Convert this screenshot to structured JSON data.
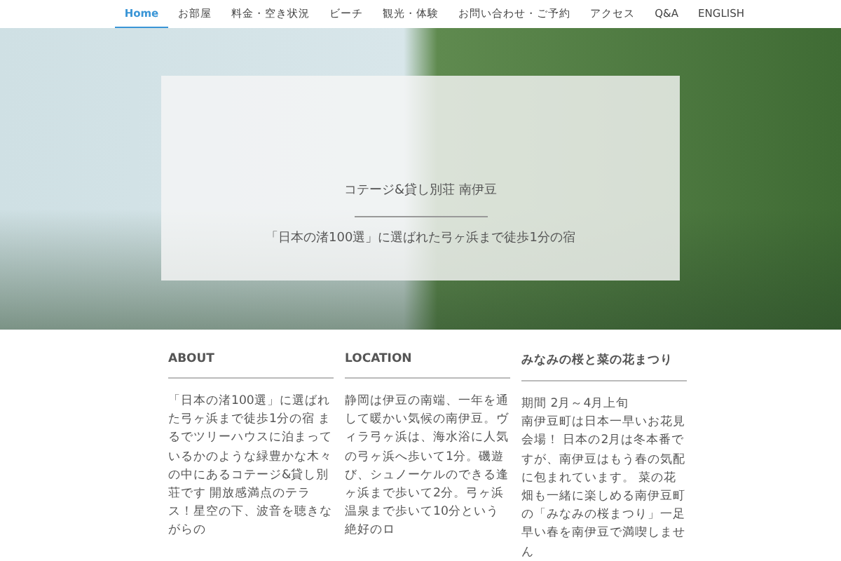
{
  "nav": {
    "items": [
      {
        "label": "Home",
        "selected": true
      },
      {
        "label": "お部屋",
        "selected": false
      },
      {
        "label": "料金・空き状況",
        "selected": false
      },
      {
        "label": "ビーチ",
        "selected": false
      },
      {
        "label": "観光・体験",
        "selected": false
      },
      {
        "label": "お問い合わせ・ご予約",
        "selected": false
      },
      {
        "label": "アクセス",
        "selected": false
      },
      {
        "label": "Q&A",
        "selected": false
      },
      {
        "label": "ENGLISH",
        "selected": false
      }
    ]
  },
  "hero": {
    "title": "コテージ&貸し別荘 南伊豆",
    "subtitle": "「日本の渚100選」に選ばれた弓ヶ浜まで徒歩1分の宿"
  },
  "widgets": [
    {
      "heading": "ABOUT",
      "paragraphs": [
        "「日本の渚100選」に選ばれた弓ヶ浜まで徒歩1分の宿 まるでツリーハウスに泊まっているかのような緑豊かな木々の中にあるコテージ&貸し別荘です 開放感満点のテラス！星空の下、波音を聴きながらの"
      ]
    },
    {
      "heading": "LOCATION",
      "paragraphs": [
        "静岡は伊豆の南端、一年を通して暖かい気候の南伊豆。ヴィラ弓ヶ浜は、海水浴に人気の弓ヶ浜へ歩いて1分。磯遊び、シュノーケルのできる逢ヶ浜まで歩いて2分。弓ヶ浜温泉まで歩いて10分という絶好のロ"
      ]
    },
    {
      "heading": "みなみの桜と菜の花まつり",
      "paragraphs": [
        "期間 2月～4月上旬",
        "南伊豆町は日本一早いお花見会場！ 日本の2月は冬本番ですが、南伊豆はもう春の気配に包まれています。 菜の花畑も一緒に楽しめる南伊豆町の「みなみの桜まつり」一足早い春を南伊豆で満喫しません"
      ]
    }
  ]
}
